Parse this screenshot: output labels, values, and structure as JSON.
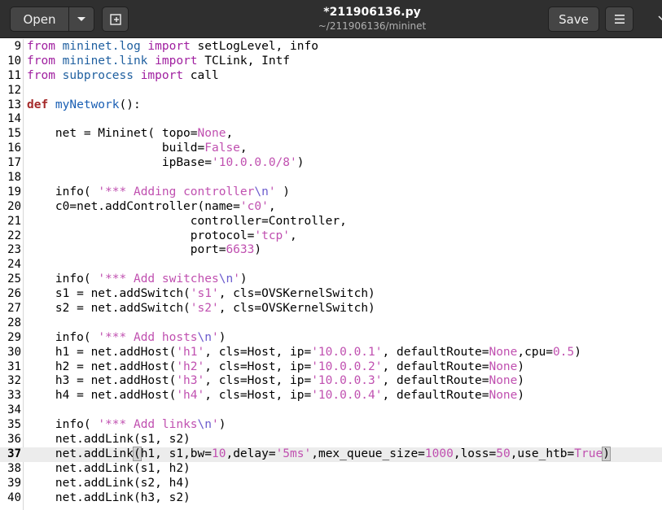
{
  "window": {
    "title": "*211906136.py",
    "path": "~/211906136/mininet"
  },
  "toolbar": {
    "open_label": "Open",
    "save_label": "Save"
  },
  "editor": {
    "current_line": 37,
    "lines": [
      {
        "n": "9",
        "segs": [
          [
            "kw",
            "from "
          ],
          [
            "mod",
            "mininet.log "
          ],
          [
            "kw",
            "import "
          ],
          [
            "",
            "setLogLevel, info"
          ]
        ]
      },
      {
        "n": "10",
        "segs": [
          [
            "kw",
            "from "
          ],
          [
            "mod",
            "mininet.link "
          ],
          [
            "kw",
            "import "
          ],
          [
            "",
            "TCLink, Intf"
          ]
        ]
      },
      {
        "n": "11",
        "segs": [
          [
            "kw",
            "from "
          ],
          [
            "mod",
            "subprocess "
          ],
          [
            "kw",
            "import "
          ],
          [
            "",
            "call"
          ]
        ]
      },
      {
        "n": "12",
        "segs": []
      },
      {
        "n": "13",
        "segs": [
          [
            "kwb",
            "def "
          ],
          [
            "fn",
            "myNetwork"
          ],
          [
            "",
            "():"
          ]
        ]
      },
      {
        "n": "14",
        "segs": []
      },
      {
        "n": "15",
        "segs": [
          [
            "",
            "    net = Mininet( topo="
          ],
          [
            "bool",
            "None"
          ],
          [
            "",
            ","
          ]
        ]
      },
      {
        "n": "16",
        "segs": [
          [
            "",
            "                   build="
          ],
          [
            "bool",
            "False"
          ],
          [
            "",
            ","
          ]
        ]
      },
      {
        "n": "17",
        "segs": [
          [
            "",
            "                   ipBase="
          ],
          [
            "str",
            "'10.0.0.0/8'"
          ],
          [
            "",
            ")"
          ]
        ]
      },
      {
        "n": "18",
        "segs": []
      },
      {
        "n": "19",
        "segs": [
          [
            "",
            "    info( "
          ],
          [
            "str",
            "'*** Adding controller"
          ],
          [
            "esc",
            "\\n"
          ],
          [
            "str",
            "'"
          ],
          [
            "",
            " )"
          ]
        ]
      },
      {
        "n": "20",
        "segs": [
          [
            "",
            "    c0=net.addController(name="
          ],
          [
            "str",
            "'c0'"
          ],
          [
            "",
            ","
          ]
        ]
      },
      {
        "n": "21",
        "segs": [
          [
            "",
            "                       controller=Controller,"
          ]
        ]
      },
      {
        "n": "22",
        "segs": [
          [
            "",
            "                       protocol="
          ],
          [
            "str",
            "'tcp'"
          ],
          [
            "",
            ","
          ]
        ]
      },
      {
        "n": "23",
        "segs": [
          [
            "",
            "                       port="
          ],
          [
            "num",
            "6633"
          ],
          [
            "",
            ")"
          ]
        ]
      },
      {
        "n": "24",
        "segs": []
      },
      {
        "n": "25",
        "segs": [
          [
            "",
            "    info( "
          ],
          [
            "str",
            "'*** Add switches"
          ],
          [
            "esc",
            "\\n"
          ],
          [
            "str",
            "'"
          ],
          [
            "",
            ")"
          ]
        ]
      },
      {
        "n": "26",
        "segs": [
          [
            "",
            "    s1 = net.addSwitch("
          ],
          [
            "str",
            "'s1'"
          ],
          [
            "",
            ", cls=OVSKernelSwitch)"
          ]
        ]
      },
      {
        "n": "27",
        "segs": [
          [
            "",
            "    s2 = net.addSwitch("
          ],
          [
            "str",
            "'s2'"
          ],
          [
            "",
            ", cls=OVSKernelSwitch)"
          ]
        ]
      },
      {
        "n": "28",
        "segs": []
      },
      {
        "n": "29",
        "segs": [
          [
            "",
            "    info( "
          ],
          [
            "str",
            "'*** Add hosts"
          ],
          [
            "esc",
            "\\n"
          ],
          [
            "str",
            "'"
          ],
          [
            "",
            ")"
          ]
        ]
      },
      {
        "n": "30",
        "segs": [
          [
            "",
            "    h1 = net.addHost("
          ],
          [
            "str",
            "'h1'"
          ],
          [
            "",
            ", cls=Host, ip="
          ],
          [
            "str",
            "'10.0.0.1'"
          ],
          [
            "",
            ", defaultRoute="
          ],
          [
            "bool",
            "None"
          ],
          [
            "",
            ",cpu="
          ],
          [
            "num",
            "0.5"
          ],
          [
            "",
            ")"
          ]
        ]
      },
      {
        "n": "31",
        "segs": [
          [
            "",
            "    h2 = net.addHost("
          ],
          [
            "str",
            "'h2'"
          ],
          [
            "",
            ", cls=Host, ip="
          ],
          [
            "str",
            "'10.0.0.2'"
          ],
          [
            "",
            ", defaultRoute="
          ],
          [
            "bool",
            "None"
          ],
          [
            "",
            ")"
          ]
        ]
      },
      {
        "n": "32",
        "segs": [
          [
            "",
            "    h3 = net.addHost("
          ],
          [
            "str",
            "'h3'"
          ],
          [
            "",
            ", cls=Host, ip="
          ],
          [
            "str",
            "'10.0.0.3'"
          ],
          [
            "",
            ", defaultRoute="
          ],
          [
            "bool",
            "None"
          ],
          [
            "",
            ")"
          ]
        ]
      },
      {
        "n": "33",
        "segs": [
          [
            "",
            "    h4 = net.addHost("
          ],
          [
            "str",
            "'h4'"
          ],
          [
            "",
            ", cls=Host, ip="
          ],
          [
            "str",
            "'10.0.0.4'"
          ],
          [
            "",
            ", defaultRoute="
          ],
          [
            "bool",
            "None"
          ],
          [
            "",
            ")"
          ]
        ]
      },
      {
        "n": "34",
        "segs": []
      },
      {
        "n": "35",
        "segs": [
          [
            "",
            "    info( "
          ],
          [
            "str",
            "'*** Add links"
          ],
          [
            "esc",
            "\\n"
          ],
          [
            "str",
            "'"
          ],
          [
            "",
            ")"
          ]
        ]
      },
      {
        "n": "36",
        "segs": [
          [
            "",
            "    net.addLink(s1, s2)"
          ]
        ]
      },
      {
        "n": "37",
        "segs": [
          [
            "",
            "    net.addLink"
          ],
          [
            "bracket",
            "("
          ],
          [
            "",
            "h1, s1,bw="
          ],
          [
            "num",
            "10"
          ],
          [
            "",
            ",delay="
          ],
          [
            "str",
            "'5ms'"
          ],
          [
            "",
            ",mex_queue_size="
          ],
          [
            "num",
            "1000"
          ],
          [
            "",
            ",loss="
          ],
          [
            "num",
            "50"
          ],
          [
            "",
            ",use_htb="
          ],
          [
            "bool",
            "True"
          ],
          [
            "bracket",
            ")"
          ]
        ]
      },
      {
        "n": "38",
        "segs": [
          [
            "",
            "    net.addLink(s1, h2)"
          ]
        ]
      },
      {
        "n": "39",
        "segs": [
          [
            "",
            "    net.addLink(s2, h4)"
          ]
        ]
      },
      {
        "n": "40",
        "segs": [
          [
            "",
            "    net.addLink(h3, s2)"
          ]
        ]
      }
    ]
  }
}
